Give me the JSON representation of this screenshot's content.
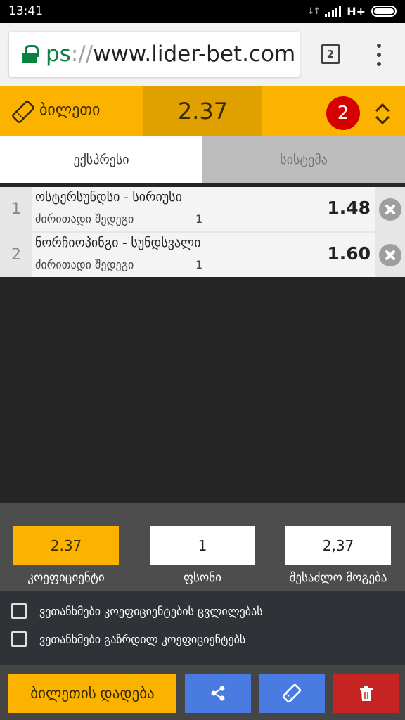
{
  "status_bar": {
    "time": "13:41",
    "network": "H+"
  },
  "browser": {
    "url_scheme": "ps",
    "url_separator": "://",
    "url_host": "www.lider-bet.com",
    "tab_count": "2"
  },
  "ticket": {
    "title": "ბილეთი",
    "total_odds": "2.37",
    "count": "2"
  },
  "tabs": [
    {
      "label": "ექსპრესი"
    },
    {
      "label": "სისტემა"
    }
  ],
  "bets": [
    {
      "index": "1",
      "match": "ოსტერსუნდსი - სირიუსი",
      "market": "ძირითადი შედეგი",
      "pick": "1",
      "odd": "1.48"
    },
    {
      "index": "2",
      "match": "ნორჩიოპინგი - სუნდსვალი",
      "market": "ძირითადი შედეგი",
      "pick": "1",
      "odd": "1.60"
    }
  ],
  "summary": {
    "odds_value": "2.37",
    "odds_label": "კოეფიციენტი",
    "stake_value": "1",
    "stake_label": "ფსონი",
    "win_value": "2,37",
    "win_label": "შესაძლო მოგება"
  },
  "options": [
    {
      "label": "ვეთანხმები კოეფიციენტების ცვლილებას"
    },
    {
      "label": "ვეთანხმები გაზრდილ კოეფიციენტებს"
    }
  ],
  "actions": {
    "place_label": "ბილეთის დადება"
  },
  "colors": {
    "accent": "#fbb300",
    "badge": "#d50000",
    "blue": "#4a7be0",
    "danger": "#c62323"
  }
}
